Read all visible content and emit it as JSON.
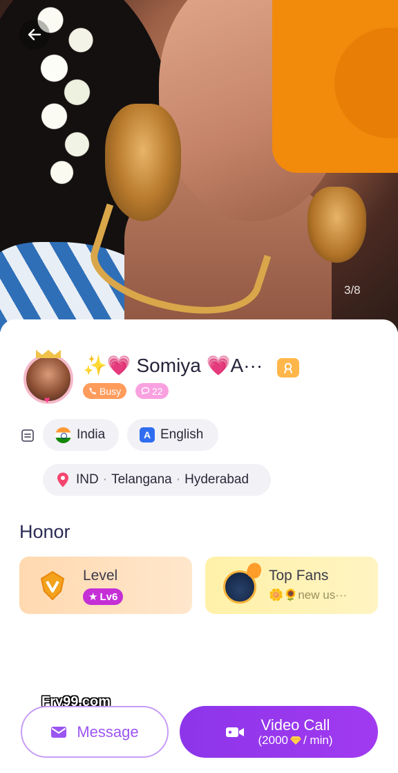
{
  "photo": {
    "counter": "3/8"
  },
  "profile": {
    "name": "✨💗 Somiya 💗A···",
    "status": "Busy",
    "count": "22",
    "country": "India",
    "language": "English",
    "language_icon_letter": "A",
    "location": {
      "country_code": "IND",
      "state": "Telangana",
      "city": "Hyderabad",
      "separator": "·"
    }
  },
  "honor": {
    "title": "Honor",
    "level": {
      "label": "Level",
      "badge": "Lv6"
    },
    "top_fans": {
      "label": "Top Fans",
      "sub": "🌼🌻new us···"
    }
  },
  "watermark": "Fry99.com",
  "actions": {
    "message_label": "Message",
    "video_label": "Video Call",
    "price_prefix": "(2000",
    "price_suffix": "/ min)"
  },
  "colors": {
    "accent_purple": "#9b3ff0",
    "busy_orange": "#ff9c5c",
    "count_pink": "#f9a1e0",
    "level_badge": "#c42fd6"
  }
}
